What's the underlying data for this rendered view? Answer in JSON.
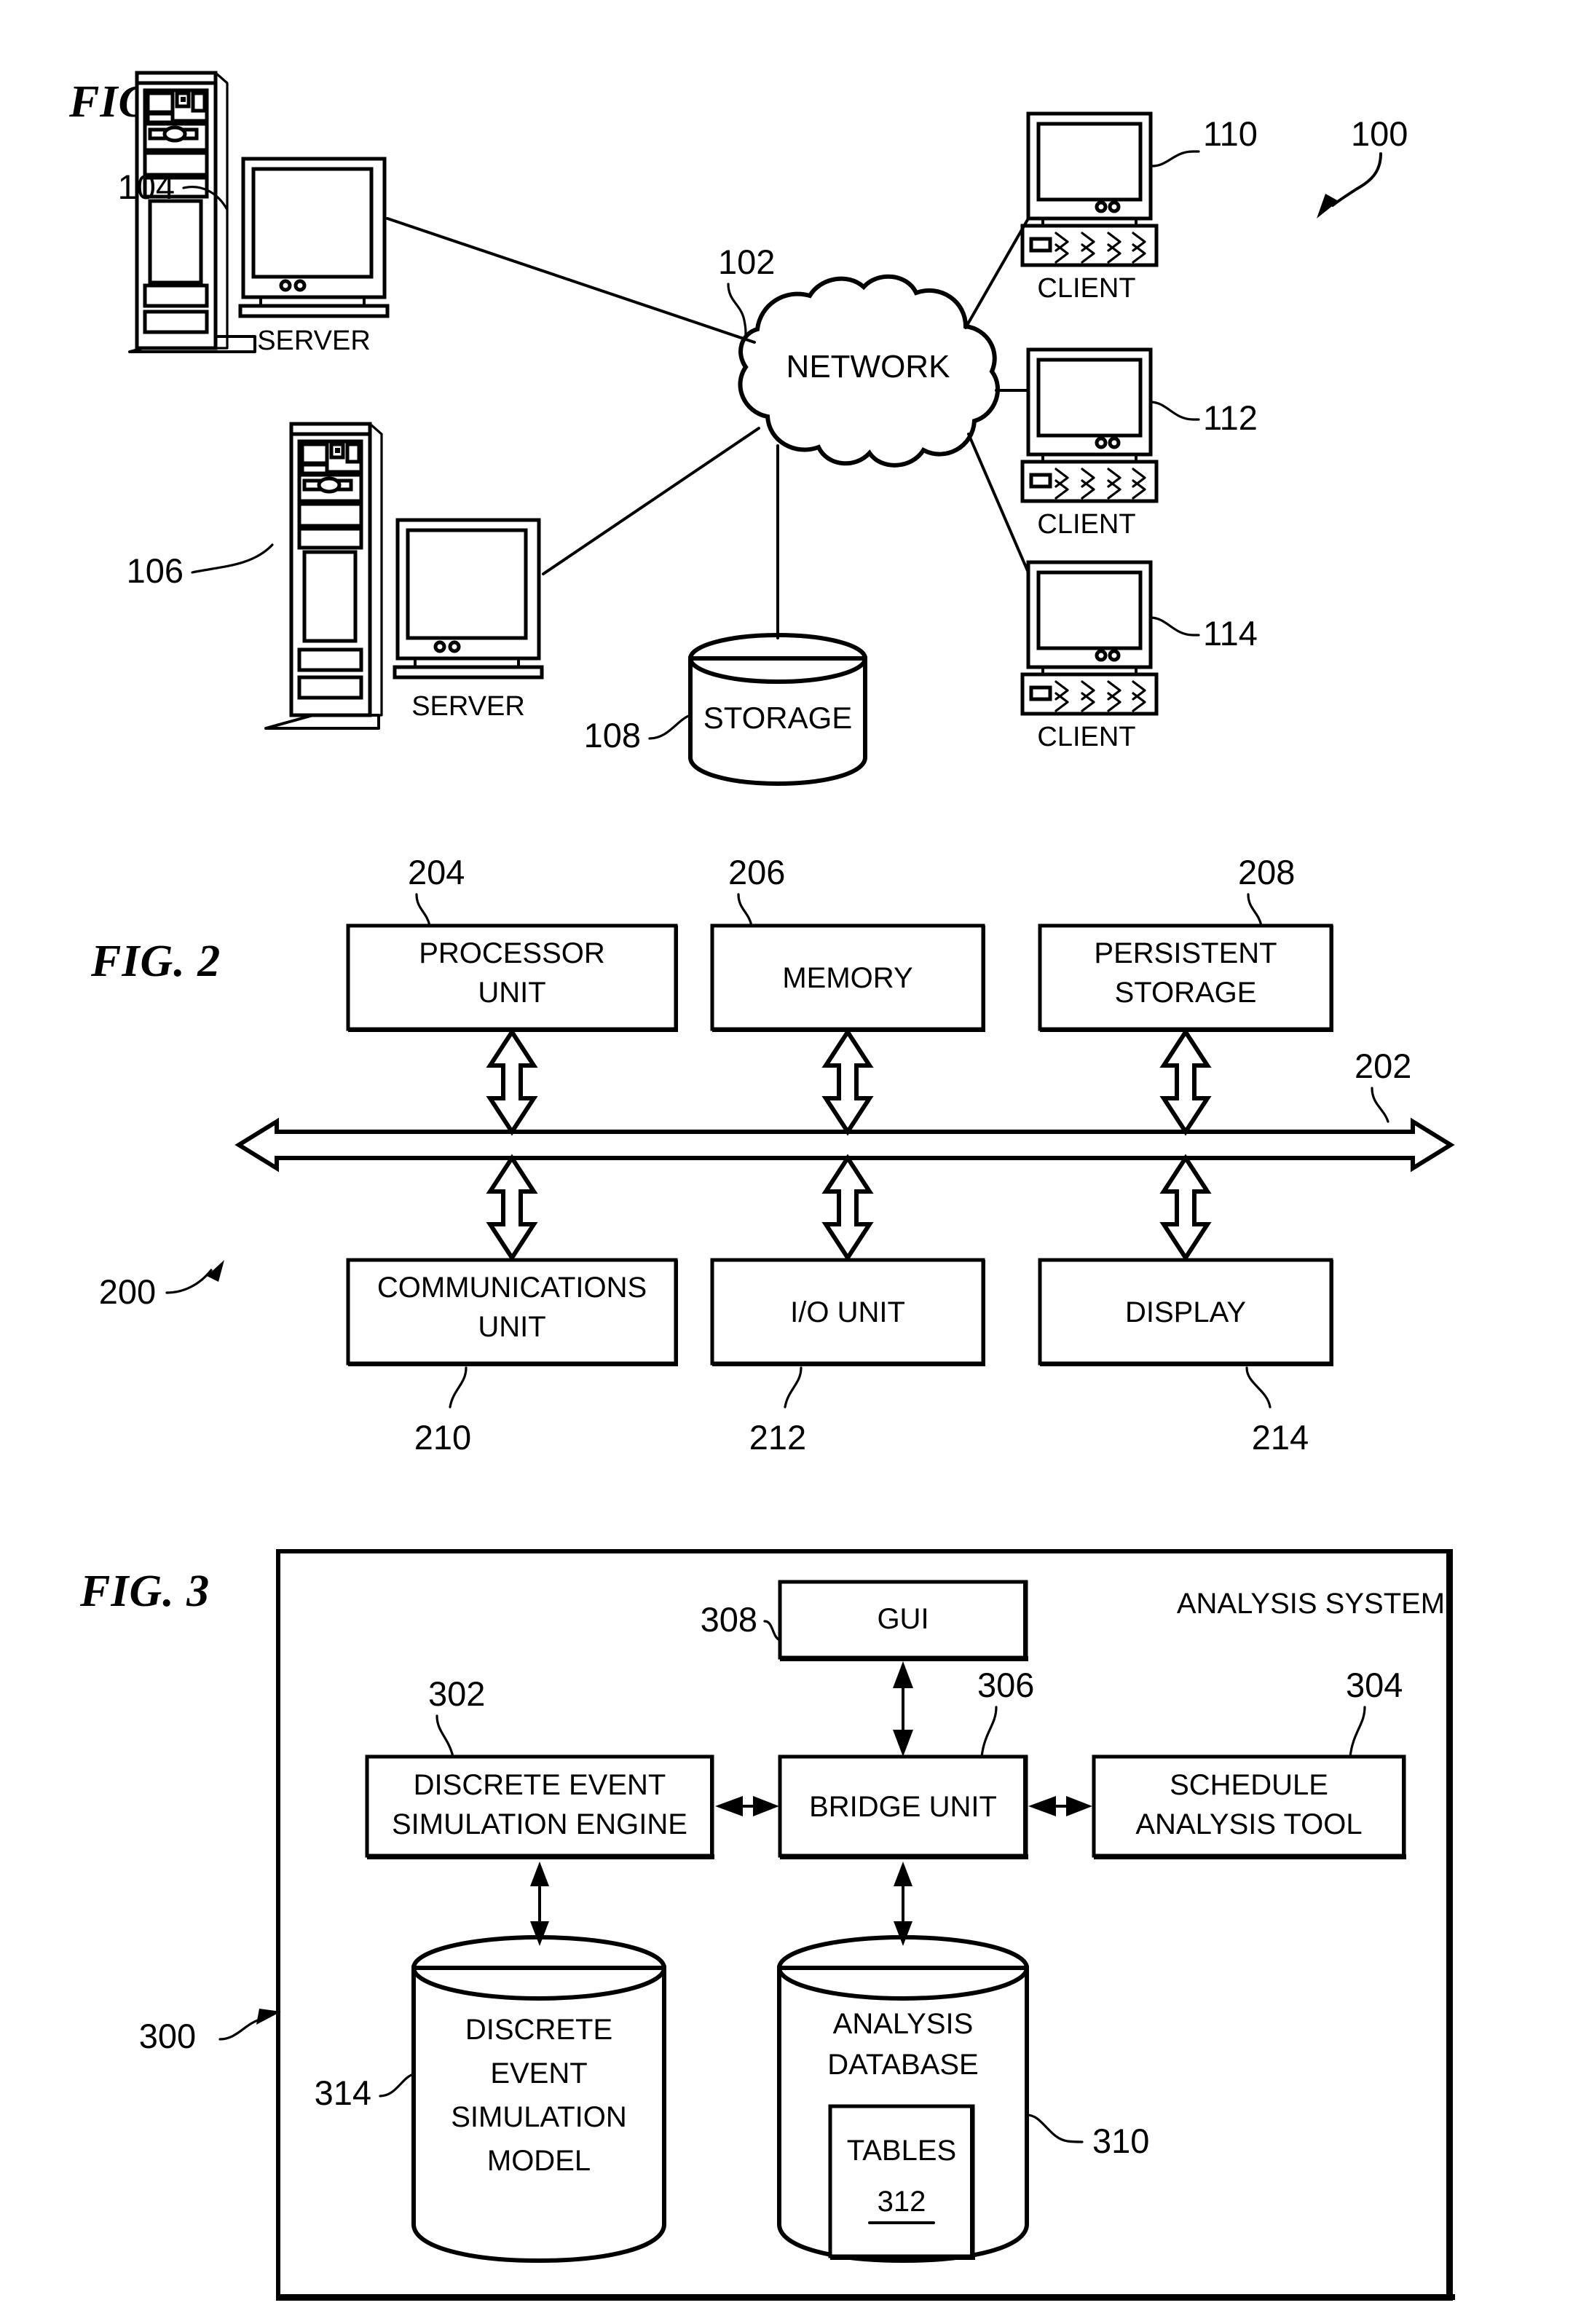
{
  "figures": [
    {
      "id": "fig1",
      "label": "FIG. 1",
      "system_ref": "100",
      "nodes": {
        "server_top": {
          "label": "SERVER",
          "ref": "104"
        },
        "server_bottom": {
          "label": "SERVER",
          "ref": "106"
        },
        "network": {
          "label": "NETWORK",
          "ref": "102"
        },
        "storage": {
          "label": "STORAGE",
          "ref": "108"
        },
        "client_1": {
          "label": "CLIENT",
          "ref": "110"
        },
        "client_2": {
          "label": "CLIENT",
          "ref": "112"
        },
        "client_3": {
          "label": "CLIENT",
          "ref": "114"
        }
      }
    },
    {
      "id": "fig2",
      "label": "FIG. 2",
      "system_ref": "200",
      "bus_ref": "202",
      "boxes": [
        {
          "label_line1": "PROCESSOR",
          "label_line2": "UNIT",
          "ref": "204"
        },
        {
          "label_line1": "MEMORY",
          "label_line2": "",
          "ref": "206"
        },
        {
          "label_line1": "PERSISTENT",
          "label_line2": "STORAGE",
          "ref": "208"
        },
        {
          "label_line1": "COMMUNICATIONS",
          "label_line2": "UNIT",
          "ref": "210"
        },
        {
          "label_line1": "I/O UNIT",
          "label_line2": "",
          "ref": "212"
        },
        {
          "label_line1": "DISPLAY",
          "label_line2": "",
          "ref": "214"
        }
      ]
    },
    {
      "id": "fig3",
      "label": "FIG. 3",
      "system_ref": "300",
      "system_title": "ANALYSIS SYSTEM",
      "boxes": [
        {
          "label_line1": "GUI",
          "label_line2": "",
          "ref": "308"
        },
        {
          "label_line1": "DISCRETE EVENT",
          "label_line2": "SIMULATION ENGINE",
          "ref": "302"
        },
        {
          "label_line1": "BRIDGE UNIT",
          "label_line2": "",
          "ref": "306"
        },
        {
          "label_line1": "SCHEDULE",
          "label_line2": "ANALYSIS TOOL",
          "ref": "304"
        }
      ],
      "cylinders": [
        {
          "lines": [
            "DISCRETE",
            "EVENT",
            "SIMULATION",
            "MODEL"
          ],
          "ref": "314",
          "inner_box": null
        },
        {
          "lines": [
            "ANALYSIS",
            "DATABASE"
          ],
          "ref": "310",
          "inner_box": {
            "label": "TABLES",
            "ref": "312"
          }
        }
      ]
    }
  ],
  "colors": {
    "ink": "#000000",
    "paper": "#ffffff"
  }
}
